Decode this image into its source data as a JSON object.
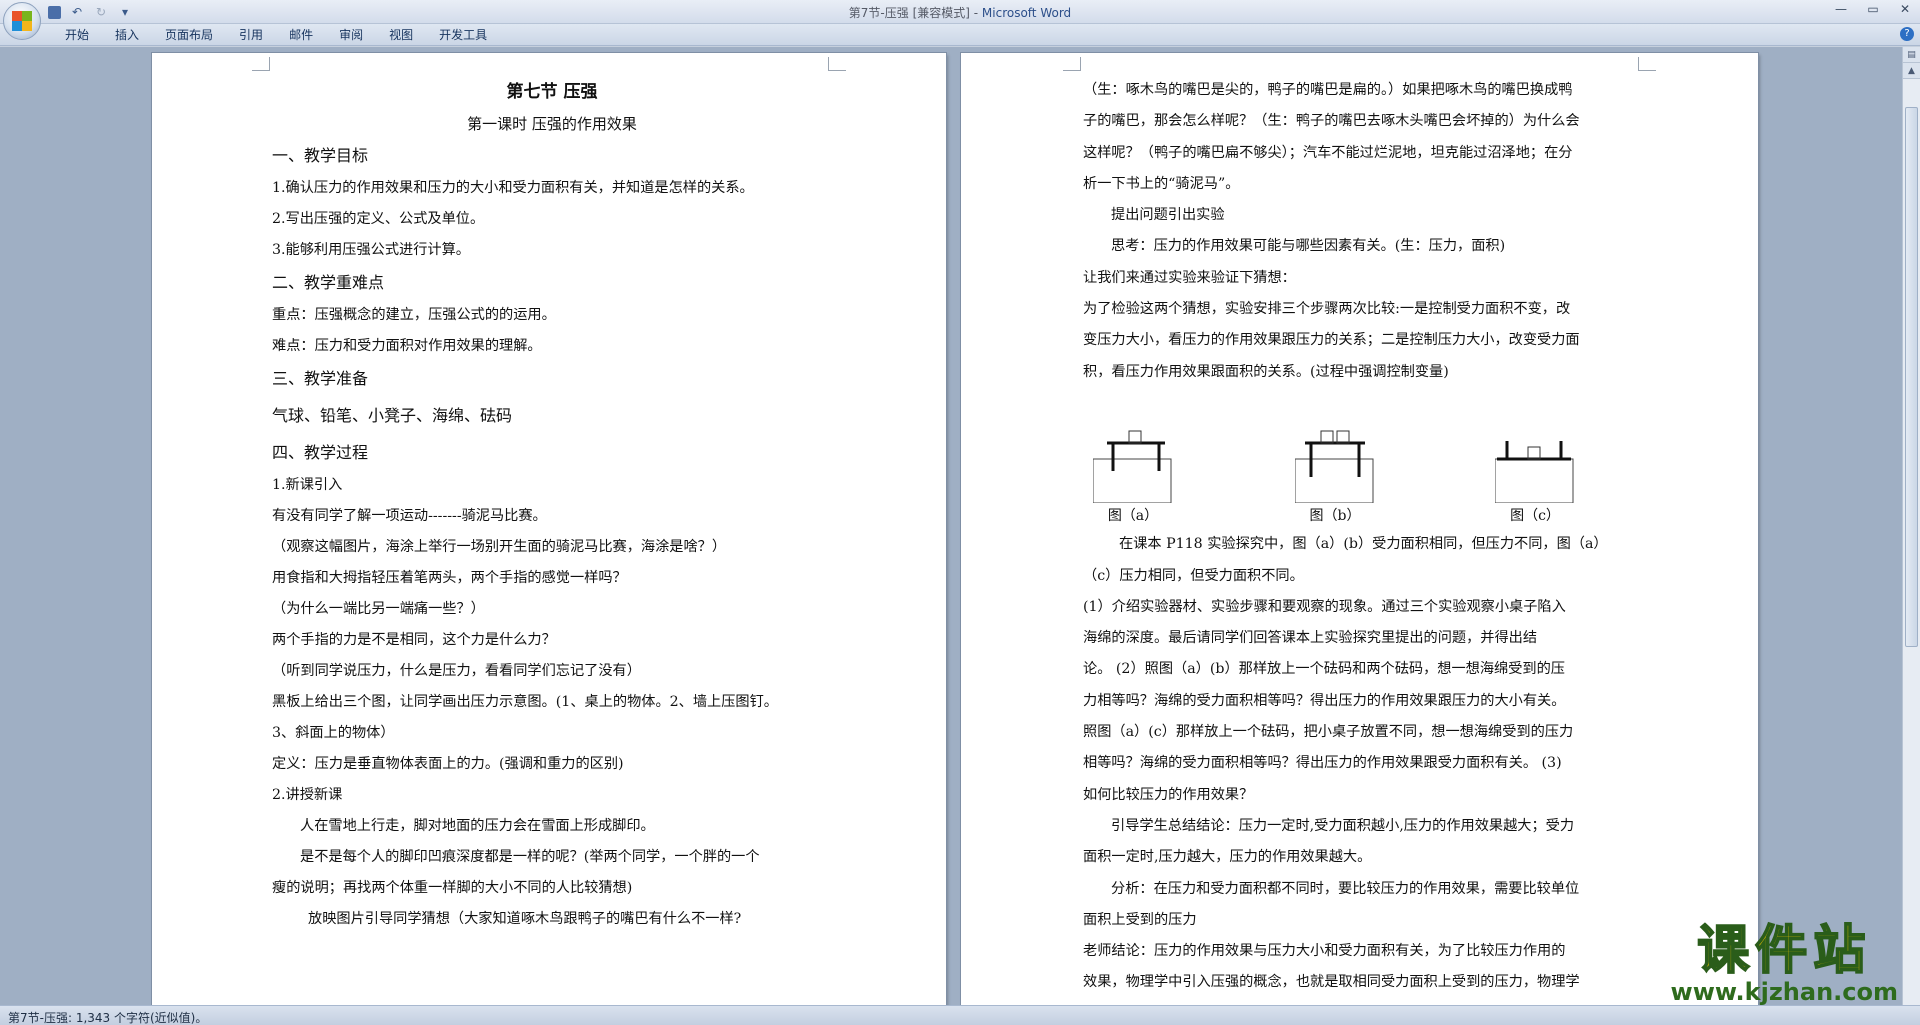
{
  "window": {
    "title": "第7节-压强 [兼容模式] - ",
    "app_name": "Microsoft Word"
  },
  "ribbon": {
    "tabs": [
      "开始",
      "插入",
      "页面布局",
      "引用",
      "邮件",
      "审阅",
      "视图",
      "开发工具"
    ]
  },
  "left_page": {
    "title": "第七节  压强",
    "subtitle": "第一课时  压强的作用效果",
    "lines": [
      {
        "text": "一、教学目标",
        "style": "h"
      },
      {
        "text": "1.确认压力的作用效果和压力的大小和受力面积有关，并知道是怎样的关系。",
        "style": "p"
      },
      {
        "text": "2.写出压强的定义、公式及单位。",
        "style": "p"
      },
      {
        "text": "3.能够利用压强公式进行计算。",
        "style": "p"
      },
      {
        "text": "二、教学重难点",
        "style": "h"
      },
      {
        "text": "重点：压强概念的建立，压强公式的的运用。",
        "style": "p"
      },
      {
        "text": "难点：压力和受力面积对作用效果的理解。",
        "style": "p"
      },
      {
        "text": "三、教学准备",
        "style": "h"
      },
      {
        "text": "气球、铅笔、小凳子、海绵、砝码",
        "style": "big"
      },
      {
        "text": "四、教学过程",
        "style": "h"
      },
      {
        "text": "1.新课引入",
        "style": "p"
      },
      {
        "text": "有没有同学了解一项运动-------骑泥马比赛。",
        "style": "p"
      },
      {
        "text": "（观察这幅图片，海涂上举行一场别开生面的骑泥马比赛，海涂是啥？）",
        "style": "p"
      },
      {
        "text": "用食指和大拇指轻压着笔两头，两个手指的感觉一样吗？",
        "style": "p"
      },
      {
        "text": "（为什么一端比另一端痛一些？）",
        "style": "p"
      },
      {
        "text": "两个手指的力是不是相同，这个力是什么力？",
        "style": "p"
      },
      {
        "text": "（听到同学说压力，什么是压力，看看同学们忘记了没有）",
        "style": "p"
      },
      {
        "text": "黑板上给出三个图，让同学画出压力示意图。(1、桌上的物体。2、墙上压图钉。",
        "style": "p"
      },
      {
        "text": "3、斜面上的物体）",
        "style": "p"
      },
      {
        "text": "定义：压力是垂直物体表面上的力。(强调和重力的区别)",
        "style": "p"
      },
      {
        "text": "2.讲授新课",
        "style": "p"
      },
      {
        "text": "人在雪地上行走，脚对地面的压力会在雪面上形成脚印。",
        "style": "p ind"
      },
      {
        "text": "是不是每个人的脚印凹痕深度都是一样的呢？(举两个同学，一个胖的一个",
        "style": "p ind"
      },
      {
        "text": "瘦的说明；再找两个体重一样脚的大小不同的人比较猜想)",
        "style": "p"
      },
      {
        "text": "放映图片引导同学猜想（大家知道啄木鸟跟鸭子的嘴巴有什么不一样?",
        "style": "p ind2"
      }
    ]
  },
  "right_page": {
    "lines_top": [
      {
        "text": "（生：啄木鸟的嘴巴是尖的，鸭子的嘴巴是扁的。）如果把啄木鸟的嘴巴换成鸭",
        "style": "rp"
      },
      {
        "text": "子的嘴巴，那会怎么样呢？（生：鸭子的嘴巴去啄木头嘴巴会坏掉的）为什么会",
        "style": "rp"
      },
      {
        "text": "这样呢？（鸭子的嘴巴扁不够尖）；汽车不能过烂泥地，坦克能过沼泽地；在分",
        "style": "rp"
      },
      {
        "text": "析一下书上的“骑泥马”。",
        "style": "rp"
      },
      {
        "text": "提出问题引出实验",
        "style": "rp ind"
      },
      {
        "text": "思考：压力的作用效果可能与哪些因素有关。(生：压力，面积)",
        "style": "rp ind"
      },
      {
        "text": "让我们来通过实验来验证下猜想：",
        "style": "rp"
      },
      {
        "text": "为了检验这两个猜想，实验安排三个步骤两次比较:一是控制受力面积不变，改",
        "style": "rp"
      },
      {
        "text": "变压力大小，看压力的作用效果跟压力的关系；二是控制压力大小，改变受力面",
        "style": "rp"
      },
      {
        "text": "积，看压力作用效果跟面积的关系。(过程中强调控制变量)",
        "style": "rp"
      },
      {
        "text": "",
        "style": "rp"
      }
    ],
    "figure_captions": [
      "图（a）",
      "图（b）",
      "图（c）"
    ],
    "lines_bottom": [
      {
        "text": "在课本 P118 实验探究中，图（a）(b）受力面积相同，但压力不同，图（a）",
        "style": "rp ind2"
      },
      {
        "text": "（c）压力相同，但受力面积不同。",
        "style": "rp"
      },
      {
        "text": "(1）介绍实验器材、实验步骤和要观察的现象。通过三个实验观察小桌子陷入",
        "style": "rp"
      },
      {
        "text": "海绵的深度。最后请同学们回答课本上实验探究里提出的问题，并得出结",
        "style": "rp"
      },
      {
        "text": "论。   (2）照图（a）(b）那样放上一个砝码和两个砝码，想一想海绵受到的压",
        "style": "rp"
      },
      {
        "text": "力相等吗？海绵的受力面积相等吗？得出压力的作用效果跟压力的大小有关。",
        "style": "rp"
      },
      {
        "text": "照图（a）(c）那样放上一个砝码，把小桌子放置不同，想一想海绵受到的压力",
        "style": "rp"
      },
      {
        "text": "相等吗？海绵的受力面积相等吗？得出压力的作用效果跟受力面积有关。  (3)",
        "style": "rp"
      },
      {
        "text": "如何比较压力的作用效果？",
        "style": "rp"
      },
      {
        "text": "引导学生总结结论：压力一定时,受力面积越小,压力的作用效果越大；受力",
        "style": "rp ind"
      },
      {
        "text": "面积一定时,压力越大，压力的作用效果越大。",
        "style": "rp"
      },
      {
        "text": "分析：在压力和受力面积都不同时，要比较压力的作用效果，需要比较单位",
        "style": "rp ind"
      },
      {
        "text": "面积上受到的压力",
        "style": "rp"
      },
      {
        "text": "老师结论：压力的作用效果与压力大小和受力面积有关，为了比较压力作用的",
        "style": "rp"
      },
      {
        "text": "效果，物理学中引入压强的概念，也就是取相同受力面积上受到的压力，物理学",
        "style": "rp"
      }
    ]
  },
  "status": {
    "text": "第7节-压强: 1,343 个字符(近似值)。"
  },
  "watermark": {
    "main": "课件站",
    "url": "www.kjzhan.com"
  }
}
